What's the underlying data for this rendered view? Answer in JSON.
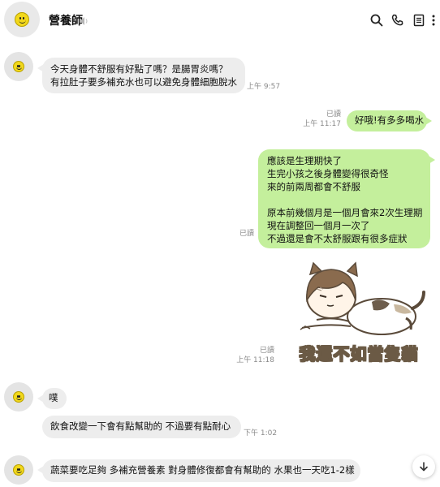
{
  "header": {
    "title": "營養師",
    "icons": [
      "volume-icon",
      "search-icon",
      "phone-icon",
      "notes-icon",
      "more-icon"
    ]
  },
  "messages": [
    {
      "side": "in",
      "text": "今天身體不舒服有好點了嗎？是腸胃炎嗎？\n有拉肚子要多補充水也可以避免身體細胞脫水",
      "time": "上午 9:57"
    },
    {
      "side": "out",
      "text": "好哦!有多多喝水",
      "read": "已讀",
      "time": "上午 11:17"
    },
    {
      "side": "out",
      "text": "應該是生理期快了\n生完小孩之後身體變得很奇怪\n來的前兩周都會不舒服\n\n原本前幾個月是一個月會來2次生理期\n現在調整回一個月一次了\n不過還是會不太舒服跟有很多症狀",
      "read": "已讀"
    },
    {
      "side": "out",
      "sticker": "cat-girl-sticker",
      "caption": "我還不如當隻貓",
      "read": "已讀",
      "time": "上午 11:18"
    },
    {
      "side": "in",
      "text": "噗"
    },
    {
      "side": "in",
      "text": "飲食改變一下會有點幫助的 不過要有點耐心",
      "time": "下午 1:02"
    },
    {
      "side": "in",
      "text": "蔬菜要吃足夠 多補充營養素 對身體修復都會有幫助的 水果也一天吃1-2樣"
    }
  ],
  "colors": {
    "incoming_bubble": "#ededed",
    "outgoing_bubble": "#c4ef9c",
    "avatar_face": "#f2d81b"
  }
}
